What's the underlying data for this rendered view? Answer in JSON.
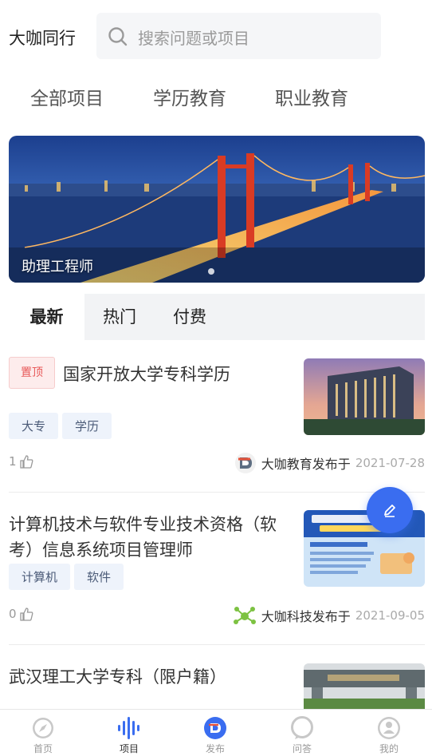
{
  "header": {
    "app_name": "大咖同行",
    "search_placeholder": "搜索问题或项目"
  },
  "categories": [
    "全部项目",
    "学历教育",
    "职业教育"
  ],
  "banner": {
    "caption": "助理工程师"
  },
  "tabs": [
    "最新",
    "热门",
    "付费"
  ],
  "posts": [
    {
      "pinned_label": "置顶",
      "title": "国家开放大学专科学历",
      "tags": [
        "大专",
        "学历"
      ],
      "likes": "1",
      "publisher": "大咖教育发布于",
      "date": "2021-07-28"
    },
    {
      "title": "计算机技术与软件专业技术资格（软考）信息系统项目管理师",
      "tags": [
        "计算机",
        "软件"
      ],
      "likes": "0",
      "publisher": "大咖科技发布于",
      "date": "2021-09-05"
    },
    {
      "title": "武汉理工大学专科（限户籍）"
    }
  ],
  "tabbar": [
    "首页",
    "项目",
    "发布",
    "问答",
    "我的"
  ],
  "colors": {
    "accent": "#3a6df0",
    "pin": "#e85a5a",
    "tag_bg": "#eef3fb"
  }
}
